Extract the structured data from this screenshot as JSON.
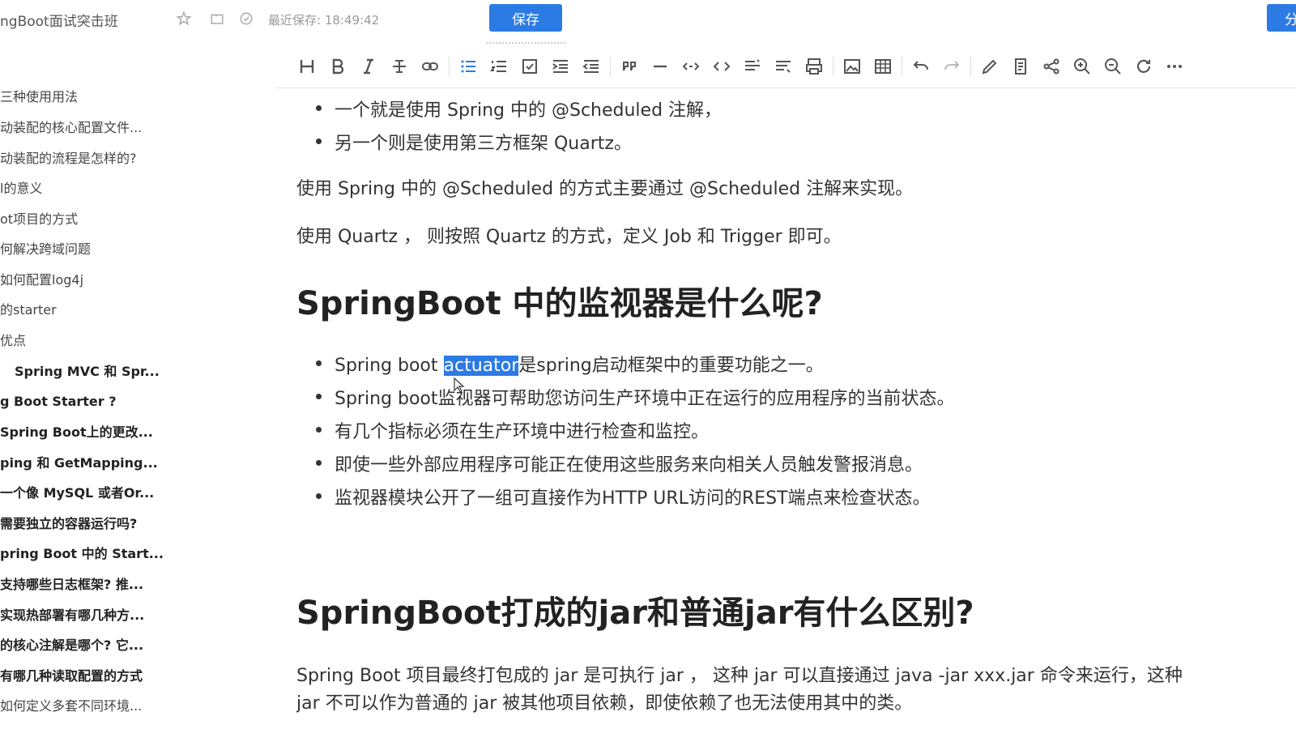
{
  "header": {
    "doc_title": "ngBoot面试突击班",
    "save_status": "最近保存: 18:49:42",
    "save_label": "保存",
    "share_label": "分"
  },
  "icons": {
    "top": [
      "star-icon",
      "folder-icon",
      "check-circle-icon"
    ],
    "toolbar": [
      "heading",
      "bold",
      "italic",
      "strikethrough",
      "link",
      "bullet-list",
      "ordered-list",
      "task-list",
      "indent-increase",
      "indent-decrease",
      "quote",
      "horizontal-rule",
      "code-inline",
      "code-block",
      "align-left",
      "align-right",
      "print",
      "image",
      "table",
      "undo",
      "redo",
      "pencil",
      "note",
      "share-nodes",
      "zoom-in",
      "zoom-out",
      "refresh",
      "more"
    ]
  },
  "sidebar": {
    "items": [
      {
        "label": "三种使用用法",
        "bold": false
      },
      {
        "label": "动装配的核心配置文件...",
        "bold": false
      },
      {
        "label": "动装配的流程是怎样的?",
        "bold": false
      },
      {
        "label": "l的意义",
        "bold": false
      },
      {
        "label": "ot项目的方式",
        "bold": false
      },
      {
        "label": "何解决跨域问题",
        "bold": false
      },
      {
        "label": "如何配置log4j",
        "bold": false
      },
      {
        "label": "的starter",
        "bold": false
      },
      {
        "label": "优点",
        "bold": false
      },
      {
        "label": "Spring MVC 和 Spr...",
        "bold": true
      },
      {
        "label": "g Boot Starter ?",
        "bold": true
      },
      {
        "label": "Spring Boot上的更改...",
        "bold": true
      },
      {
        "label": "ping 和 GetMapping...",
        "bold": true
      },
      {
        "label": "一个像 MySQL 或者Or...",
        "bold": true
      },
      {
        "label": "需要独立的容器运行吗?",
        "bold": true
      },
      {
        "label": "pring Boot 中的 Start...",
        "bold": true
      },
      {
        "label": "支持哪些日志框架? 推...",
        "bold": true
      },
      {
        "label": "实现热部署有哪几种方...",
        "bold": true
      },
      {
        "label": "的核心注解是哪个? 它...",
        "bold": true
      },
      {
        "label": "有哪几种读取配置的方式",
        "bold": true
      },
      {
        "label": "如何定义多套不同环境...",
        "bold": false
      }
    ]
  },
  "content": {
    "top_bullets": [
      "一个就是使用 Spring 中的 @Scheduled 注解，",
      "另一个则是使用第三方框架 Quartz。"
    ],
    "para1": "使用 Spring 中的 @Scheduled 的方式主要通过 @Scheduled 注解来实现。",
    "para2": "使用 Quartz ， 则按照 Quartz 的方式，定义 Job 和 Trigger 即可。",
    "h1_marker": "H1",
    "heading1": "SpringBoot 中的监视器是什么呢?",
    "bullet1_pre": "Spring boot ",
    "bullet1_sel": "actuator",
    "bullet1_post": "是spring启动框架中的重要功能之一。",
    "bullets": [
      "Spring boot监视器可帮助您访问生产环境中正在运行的应用程序的当前状态。",
      "有几个指标必须在生产环境中进行检查和监控。",
      "即使一些外部应用程序可能正在使用这些服务来向相关人员触发警报消息。",
      "监视器模块公开了一组可直接作为HTTP URL访问的REST端点来检查状态。"
    ],
    "heading2": "SpringBoot打成的jar和普通jar有什么区别?",
    "para3_line1": "Spring Boot 项目最终打包成的 jar 是可执行 jar ， 这种 jar 可以直接通过 java -jar xxx.jar 命令来运行，这种",
    "para3_line2": "jar 不可以作为普通的 jar 被其他项目依赖，即使依赖了也无法使用其中的类。"
  },
  "colors": {
    "accent": "#2c7be5",
    "selection": "#2c7be5"
  }
}
